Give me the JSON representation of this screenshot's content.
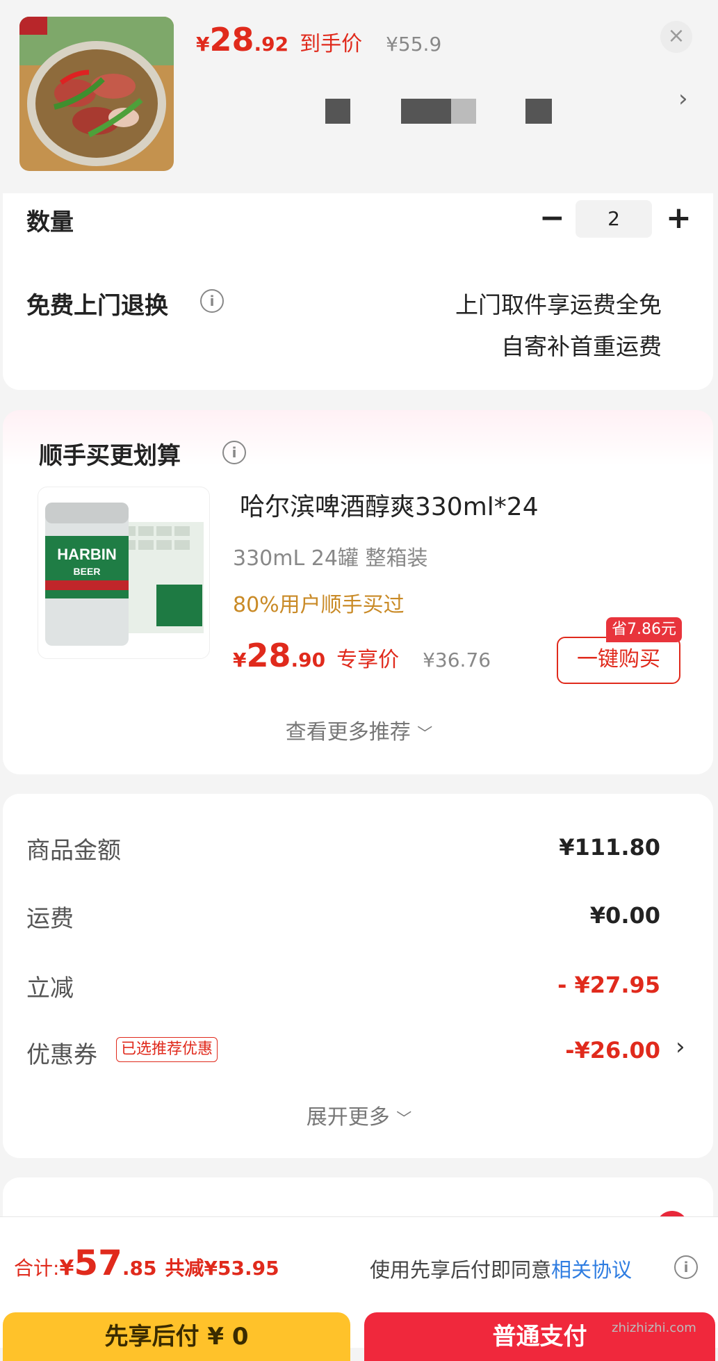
{
  "header": {
    "currency": "¥",
    "price_int": "28",
    "price_dec": ".92",
    "price_label": "到手价",
    "original_price": "¥55.9",
    "close_glyph": "×",
    "arrow_glyph": "›"
  },
  "quantity": {
    "label": "数量",
    "minus": "−",
    "value": "2",
    "plus": "+"
  },
  "returns": {
    "label": "免费上门退换",
    "line1": "上门取件享运费全免",
    "line2": "自寄补首重运费"
  },
  "recommend": {
    "title": "顺手买更划算",
    "product_title": "哈尔滨啤酒醇爽330ml*24",
    "spec": "330mL 24罐 整箱装",
    "social_proof": "80%用户顺手买过",
    "currency": "¥",
    "price_int": "28",
    "price_dec": ".90",
    "price_label": "专享价",
    "original_price": "¥36.76",
    "save_tag": "省7.86元",
    "buy_button": "一键购买",
    "more": "查看更多推荐",
    "can_brand": "HARBIN",
    "can_sub": "BEER"
  },
  "summary": {
    "goods_label": "商品金额",
    "goods_value": "¥111.80",
    "shipping_label": "运费",
    "shipping_value": "¥0.00",
    "discount_label": "立减",
    "discount_value": "- ¥27.95",
    "coupon_label": "优惠券",
    "coupon_tag": "已选推荐优惠",
    "coupon_value": "-¥26.00",
    "expand": "展开更多"
  },
  "footer": {
    "total_label": "合计: ",
    "currency": "¥",
    "total_int": "57",
    "total_dec": ".85",
    "saved": "共减¥53.95",
    "agree_text": "使用先享后付即同意",
    "agree_link": "相关协议",
    "btn_left": "先享后付 ¥ 0",
    "btn_right": "普通支付"
  },
  "watermark": "zhizhizhi.com",
  "colors": {
    "accent_red": "#e02a1c",
    "link_blue": "#2f7de1",
    "orange": "#c98a26"
  }
}
